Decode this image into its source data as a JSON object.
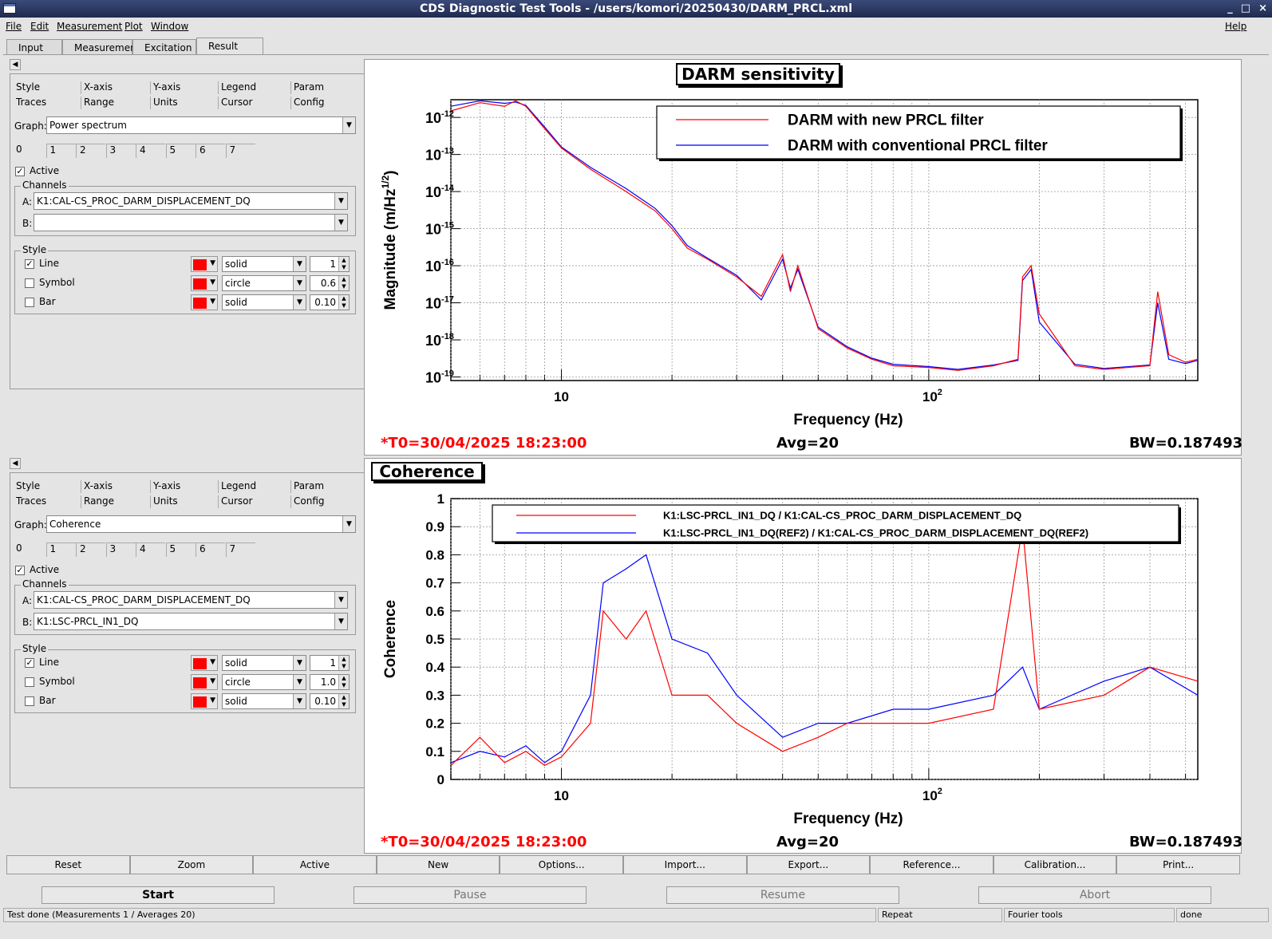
{
  "window": {
    "title": "CDS Diagnostic Test Tools - /users/komori/20250430/DARM_PRCL.xml",
    "controls": [
      "_",
      "□",
      "×"
    ]
  },
  "menu": {
    "file": "File",
    "edit": "Edit",
    "measurement": "Measurement",
    "plot": "Plot",
    "window": "Window",
    "help": "Help"
  },
  "tabs": [
    "Input",
    "Measurement",
    "Excitation",
    "Result"
  ],
  "selected_tab": "Result",
  "panels": [
    {
      "subtabs_row1": [
        "Style",
        "X-axis",
        "Y-axis",
        "Legend",
        "Param"
      ],
      "subtabs_row2": [
        "Traces",
        "Range",
        "Units",
        "Cursor",
        "Config"
      ],
      "graph_label": "Graph:",
      "graph_value": "Power spectrum",
      "trace_tabs": [
        "0",
        "1",
        "2",
        "3",
        "4",
        "5",
        "6",
        "7"
      ],
      "active_label": "Active",
      "channels_label": "Channels",
      "channel_a_label": "A:",
      "channel_a": "K1:CAL-CS_PROC_DARM_DISPLACEMENT_DQ",
      "channel_b_label": "B:",
      "channel_b": "",
      "style_label": "Style",
      "style_rows": [
        {
          "label": "Line",
          "checked": true,
          "type": "solid",
          "value": "1"
        },
        {
          "label": "Symbol",
          "checked": false,
          "type": "circle",
          "value": "0.6"
        },
        {
          "label": "Bar",
          "checked": false,
          "type": "solid",
          "value": "0.10"
        }
      ]
    },
    {
      "subtabs_row1": [
        "Style",
        "X-axis",
        "Y-axis",
        "Legend",
        "Param"
      ],
      "subtabs_row2": [
        "Traces",
        "Range",
        "Units",
        "Cursor",
        "Config"
      ],
      "graph_label": "Graph:",
      "graph_value": "Coherence",
      "trace_tabs": [
        "0",
        "1",
        "2",
        "3",
        "4",
        "5",
        "6",
        "7"
      ],
      "active_label": "Active",
      "channels_label": "Channels",
      "channel_a_label": "A:",
      "channel_a": "K1:CAL-CS_PROC_DARM_DISPLACEMENT_DQ",
      "channel_b_label": "B:",
      "channel_b": "K1:LSC-PRCL_IN1_DQ",
      "style_label": "Style",
      "style_rows": [
        {
          "label": "Line",
          "checked": true,
          "type": "solid",
          "value": "1"
        },
        {
          "label": "Symbol",
          "checked": false,
          "type": "circle",
          "value": "1.0"
        },
        {
          "label": "Bar",
          "checked": false,
          "type": "solid",
          "value": "0.10"
        }
      ]
    }
  ],
  "plots": [
    {
      "title": "DARM sensitivity",
      "footer_left": "*T0=30/04/2025 18:23:00",
      "footer_mid": "Avg=20",
      "footer_right": "BW=0.187493",
      "xlabel": "Frequency (Hz)",
      "ylabel": "Magnitude (m/Hz",
      "ylabel_sup": "1/2",
      "ylabel_end": ")",
      "legend": [
        "DARM with new PRCL filter",
        "DARM with conventional PRCL filter"
      ],
      "xticks": [
        "10",
        "10",
        "2"
      ],
      "yticks": [
        "10",
        "-12",
        "10",
        "-13",
        "10",
        "-14",
        "10",
        "-15",
        "10",
        "-16",
        "10",
        "-17",
        "10",
        "-18",
        "10",
        "-19"
      ]
    },
    {
      "title": "Coherence",
      "footer_left": "*T0=30/04/2025 18:23:00",
      "footer_mid": "Avg=20",
      "footer_right": "BW=0.187493",
      "xlabel": "Frequency (Hz)",
      "ylabel": "Coherence",
      "legend": [
        "K1:LSC-PRCL_IN1_DQ / K1:CAL-CS_PROC_DARM_DISPLACEMENT_DQ",
        "K1:LSC-PRCL_IN1_DQ(REF2) / K1:CAL-CS_PROC_DARM_DISPLACEMENT_DQ(REF2)"
      ],
      "xticks": [
        "10",
        "10",
        "2"
      ],
      "yticks": [
        "1",
        "0.9",
        "0.8",
        "0.7",
        "0.6",
        "0.5",
        "0.4",
        "0.3",
        "0.2",
        "0.1",
        "0"
      ]
    }
  ],
  "chart_data": [
    {
      "type": "line",
      "title": "DARM sensitivity",
      "xlabel": "Frequency (Hz)",
      "ylabel": "Magnitude (m/Hz^1/2)",
      "xscale": "log",
      "yscale": "log",
      "xlim": [
        5,
        540
      ],
      "ylim": [
        8e-20,
        3e-12
      ],
      "grid": true,
      "legend_position": "top-right",
      "series": [
        {
          "name": "DARM with new PRCL filter",
          "color": "#ff0000",
          "x": [
            5,
            6,
            7,
            7.5,
            8,
            9,
            10,
            12,
            15,
            18,
            20,
            22,
            25,
            30,
            35,
            40,
            42,
            44,
            50,
            60,
            70,
            80,
            100,
            120,
            150,
            175,
            180,
            190,
            200,
            250,
            300,
            400,
            420,
            450,
            500,
            540
          ],
          "y": [
            1.5e-12,
            2.5e-12,
            2e-12,
            2.8e-12,
            2e-12,
            5e-13,
            1.5e-13,
            4e-14,
            1e-14,
            3e-15,
            1e-15,
            3e-16,
            1.5e-16,
            5e-17,
            1.5e-17,
            2e-16,
            2e-17,
            1e-16,
            2e-18,
            6e-19,
            3e-19,
            2e-19,
            1.8e-19,
            1.5e-19,
            2e-19,
            3e-19,
            5e-17,
            1e-16,
            5e-18,
            2e-19,
            1.6e-19,
            2e-19,
            2e-17,
            4e-19,
            2.5e-19,
            3e-19
          ]
        },
        {
          "name": "DARM with conventional PRCL filter",
          "color": "#0000ff",
          "x": [
            5,
            6,
            7,
            7.5,
            8,
            9,
            10,
            12,
            15,
            18,
            20,
            22,
            25,
            30,
            35,
            40,
            42,
            44,
            50,
            60,
            70,
            80,
            100,
            120,
            150,
            175,
            180,
            190,
            200,
            250,
            300,
            400,
            420,
            450,
            500,
            540
          ],
          "y": [
            2e-12,
            2.8e-12,
            2.4e-12,
            2.6e-12,
            2.1e-12,
            5.5e-13,
            1.6e-13,
            4.5e-14,
            1.2e-14,
            3.5e-15,
            1.2e-15,
            3.5e-16,
            1.6e-16,
            5.5e-17,
            1.2e-17,
            1.5e-16,
            2.5e-17,
            8e-17,
            2.2e-18,
            6.5e-19,
            3.2e-19,
            2.2e-19,
            1.9e-19,
            1.6e-19,
            2.1e-19,
            2.8e-19,
            4e-17,
            8e-17,
            3e-18,
            2.2e-19,
            1.7e-19,
            2.1e-19,
            1e-17,
            3e-19,
            2.3e-19,
            2.8e-19
          ]
        }
      ]
    },
    {
      "type": "line",
      "title": "Coherence",
      "xlabel": "Frequency (Hz)",
      "ylabel": "Coherence",
      "xscale": "log",
      "yscale": "linear",
      "xlim": [
        5,
        540
      ],
      "ylim": [
        0,
        1
      ],
      "grid": true,
      "legend_position": "top-right",
      "series": [
        {
          "name": "K1:LSC-PRCL_IN1_DQ / K1:CAL-CS_PROC_DARM_DISPLACEMENT_DQ",
          "color": "#ff0000",
          "x": [
            5,
            6,
            7,
            8,
            9,
            10,
            12,
            13,
            15,
            17,
            20,
            25,
            30,
            40,
            50,
            60,
            80,
            100,
            150,
            180,
            200,
            300,
            400,
            540
          ],
          "y": [
            0.05,
            0.15,
            0.06,
            0.1,
            0.05,
            0.08,
            0.2,
            0.6,
            0.5,
            0.6,
            0.3,
            0.3,
            0.2,
            0.1,
            0.15,
            0.2,
            0.2,
            0.2,
            0.25,
            0.9,
            0.25,
            0.3,
            0.4,
            0.35
          ]
        },
        {
          "name": "K1:LSC-PRCL_IN1_DQ(REF2) / K1:CAL-CS_PROC_DARM_DISPLACEMENT_DQ(REF2)",
          "color": "#0000ff",
          "x": [
            5,
            6,
            7,
            8,
            9,
            10,
            12,
            13,
            15,
            17,
            20,
            25,
            30,
            40,
            50,
            60,
            80,
            100,
            150,
            180,
            200,
            300,
            400,
            540
          ],
          "y": [
            0.06,
            0.1,
            0.08,
            0.12,
            0.06,
            0.1,
            0.3,
            0.7,
            0.75,
            0.8,
            0.5,
            0.45,
            0.3,
            0.15,
            0.2,
            0.2,
            0.25,
            0.25,
            0.3,
            0.4,
            0.25,
            0.35,
            0.4,
            0.3
          ]
        }
      ]
    }
  ],
  "buttons": [
    "Reset",
    "Zoom",
    "Active",
    "New",
    "Options...",
    "Import...",
    "Export...",
    "Reference...",
    "Calibration...",
    "Print..."
  ],
  "controls": {
    "start": "Start",
    "pause": "Pause",
    "resume": "Resume",
    "abort": "Abort"
  },
  "status": {
    "main": "Test done (Measurements 1 / Averages 20)",
    "repeat": "Repeat",
    "fourier": "Fourier tools",
    "state": "done"
  }
}
